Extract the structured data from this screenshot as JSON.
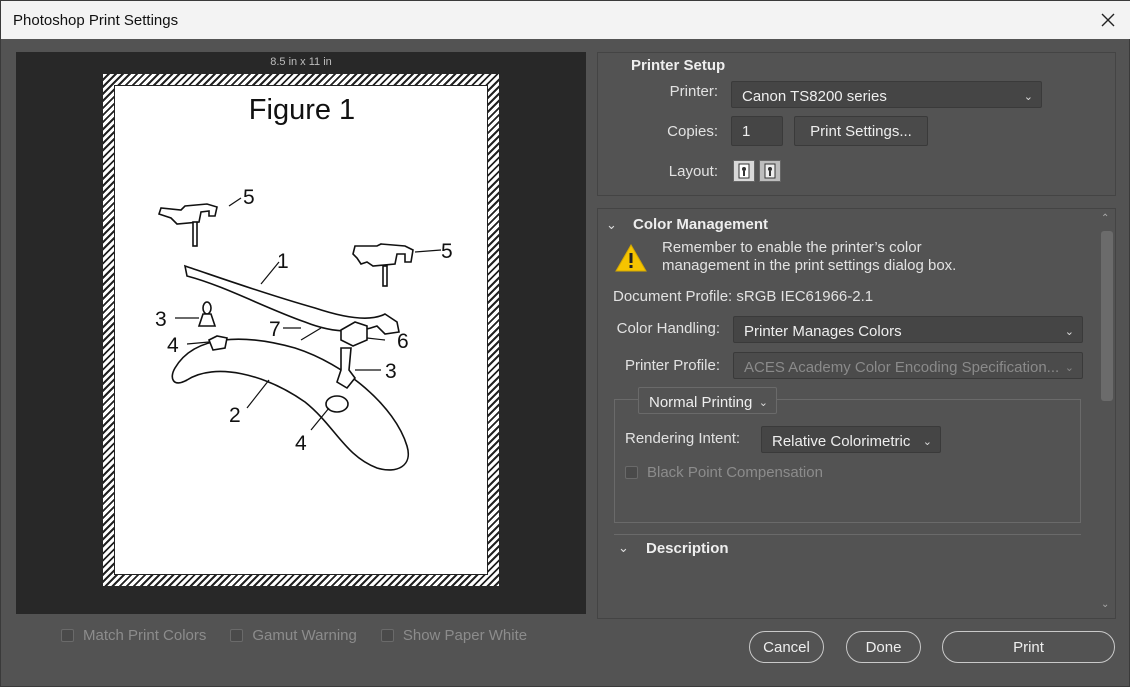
{
  "window": {
    "title": "Photoshop Print Settings"
  },
  "preview": {
    "paper_size": "8.5 in x 11 in",
    "figure_title": "Figure 1",
    "callouts": [
      "5",
      "1",
      "5",
      "3",
      "7",
      "6",
      "4",
      "3",
      "2",
      "4"
    ]
  },
  "preview_options": [
    {
      "label": "Match Print Colors",
      "checked": false
    },
    {
      "label": "Gamut Warning",
      "checked": false
    },
    {
      "label": "Show Paper White",
      "checked": false
    }
  ],
  "printer_setup": {
    "heading": "Printer Setup",
    "printer_label": "Printer:",
    "printer_value": "Canon TS8200 series",
    "copies_label": "Copies:",
    "copies_value": "1",
    "print_settings_button": "Print Settings...",
    "layout_label": "Layout:"
  },
  "color_management": {
    "heading": "Color Management",
    "warning_line1": "Remember to enable the printer’s color",
    "warning_line2": "management in the print settings dialog box.",
    "document_profile": "Document Profile: sRGB IEC61966-2.1",
    "color_handling_label": "Color Handling:",
    "color_handling_value": "Printer Manages Colors",
    "printer_profile_label": "Printer Profile:",
    "printer_profile_value": "ACES Academy Color Encoding Specification...",
    "printing_mode": "Normal Printing",
    "rendering_intent_label": "Rendering Intent:",
    "rendering_intent_value": "Relative Colorimetric",
    "black_point_label": "Black Point Compensation",
    "black_point_checked": false
  },
  "description": {
    "heading": "Description"
  },
  "footer": {
    "cancel": "Cancel",
    "done": "Done",
    "print": "Print"
  },
  "colors": {
    "panel_bg": "#535353",
    "preview_bg": "#282828",
    "warning": "#f5c400"
  }
}
